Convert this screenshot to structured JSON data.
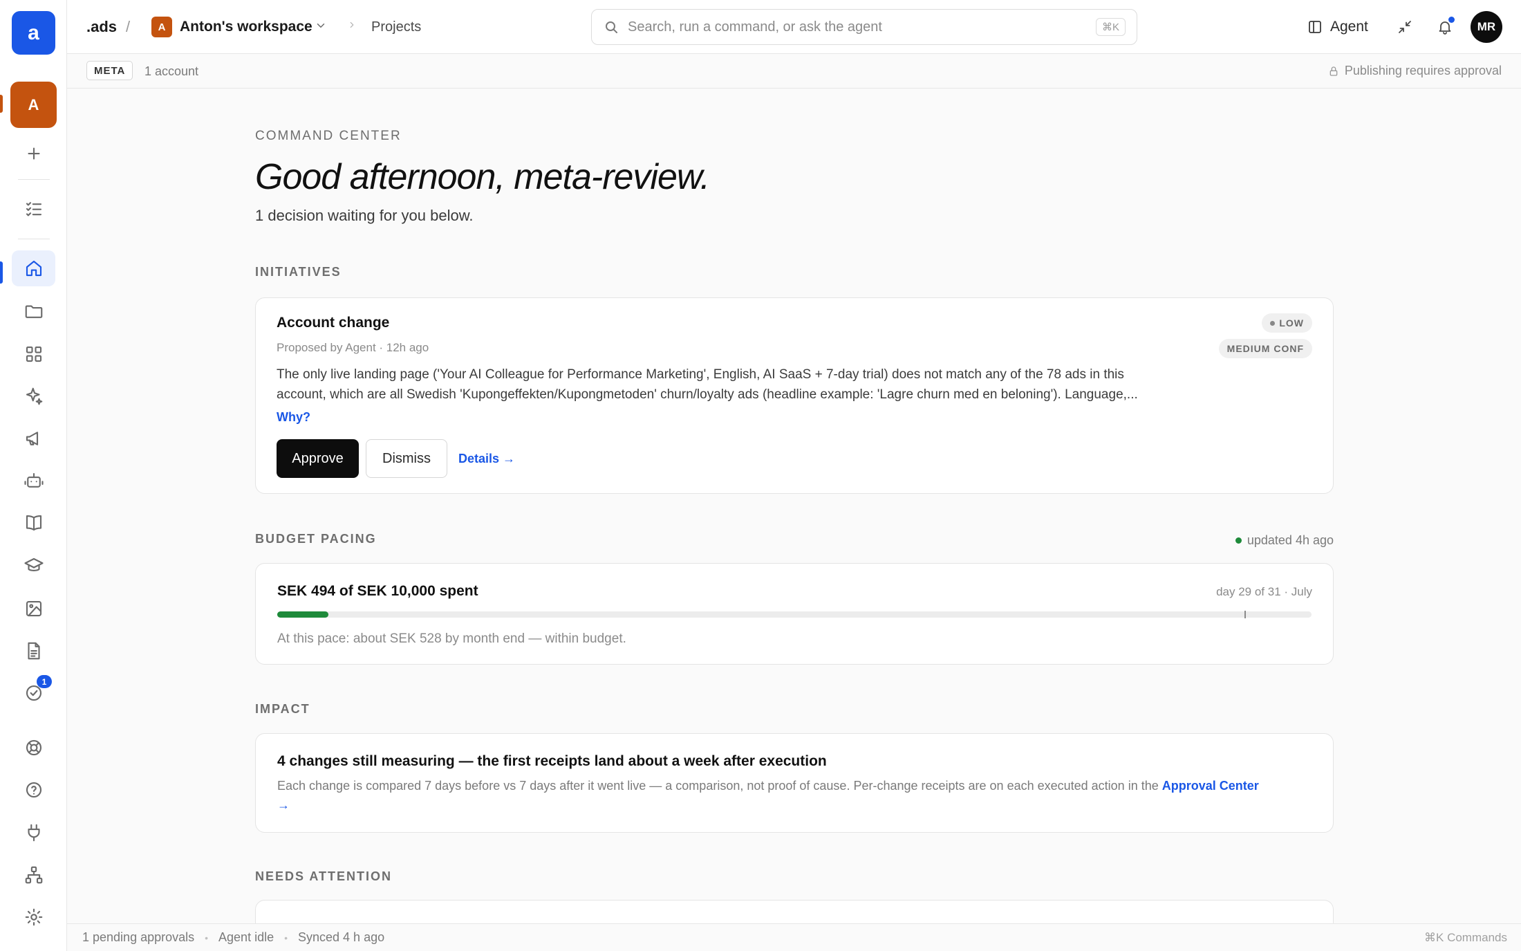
{
  "rail": {
    "logo_letter": "a",
    "workspace_letter": "A",
    "approvals_badge": "1"
  },
  "topbar": {
    "brand": ".ads",
    "separator": "/",
    "workspace_badge": "A",
    "workspace_name": "Anton's workspace",
    "breadcrumb_current": "Projects",
    "search_placeholder": "Search, run a command, or ask the agent",
    "search_shortcut": "⌘K",
    "agent_label": "Agent",
    "avatar_initials": "MR",
    "notification_dot_color": "#1a57e6"
  },
  "subbar": {
    "platform": "META",
    "account_count": "1 account",
    "publish_note": "Publishing requires approval"
  },
  "main": {
    "eyebrow": "COMMAND CENTER",
    "greeting": "Good afternoon, meta-review.",
    "subgreeting": "1 decision waiting for you below."
  },
  "initiatives": {
    "label": "INITIATIVES",
    "card": {
      "title": "Account change",
      "meta": "Proposed by Agent · 12h ago",
      "risk": "LOW",
      "confidence": "MEDIUM CONF",
      "description_line1": "The only live landing page ('Your AI Colleague for Performance Marketing', English, AI SaaS + 7-day trial) does not match any of the 78 ads in this",
      "description_line2": "account, which are all Swedish 'Kupongeffekten/Kupongmetoden' churn/loyalty ads (headline example: 'Lagre churn med en beloning'). Language,...",
      "why_label": "Why?",
      "approve_label": "Approve",
      "dismiss_label": "Dismiss",
      "details_label": "Details →"
    }
  },
  "budget": {
    "label": "BUDGET PACING",
    "updated": "updated 4h ago",
    "title": "SEK 494 of SEK 10,000 spent",
    "day": "day 29 of 31 · July",
    "spent_fraction": 0.0494,
    "day_fraction": 0.935,
    "note": "At this pace: about SEK 528 by month end — within budget.",
    "fill_color": "#1e8a3a"
  },
  "impact": {
    "label": "IMPACT",
    "title": "4 changes still measuring — the first receipts land about a week after execution",
    "description": "Each change is compared 7 days before vs 7 days after it went live — a comparison, not proof of cause. Per-change receipts are on each executed action in the ",
    "link_label": "Approval Center",
    "link_arrow": "→"
  },
  "needs_attention": {
    "label": "NEEDS ATTENTION"
  },
  "statusbar": {
    "pending": "1 pending approvals",
    "agent_state": "Agent idle",
    "synced": "Synced 4 h ago",
    "commands_hint": "⌘K Commands",
    "separator": "•"
  },
  "colors": {
    "accent": "#1a57e6",
    "workspace": "#c4530f",
    "success": "#1e8a3a"
  }
}
